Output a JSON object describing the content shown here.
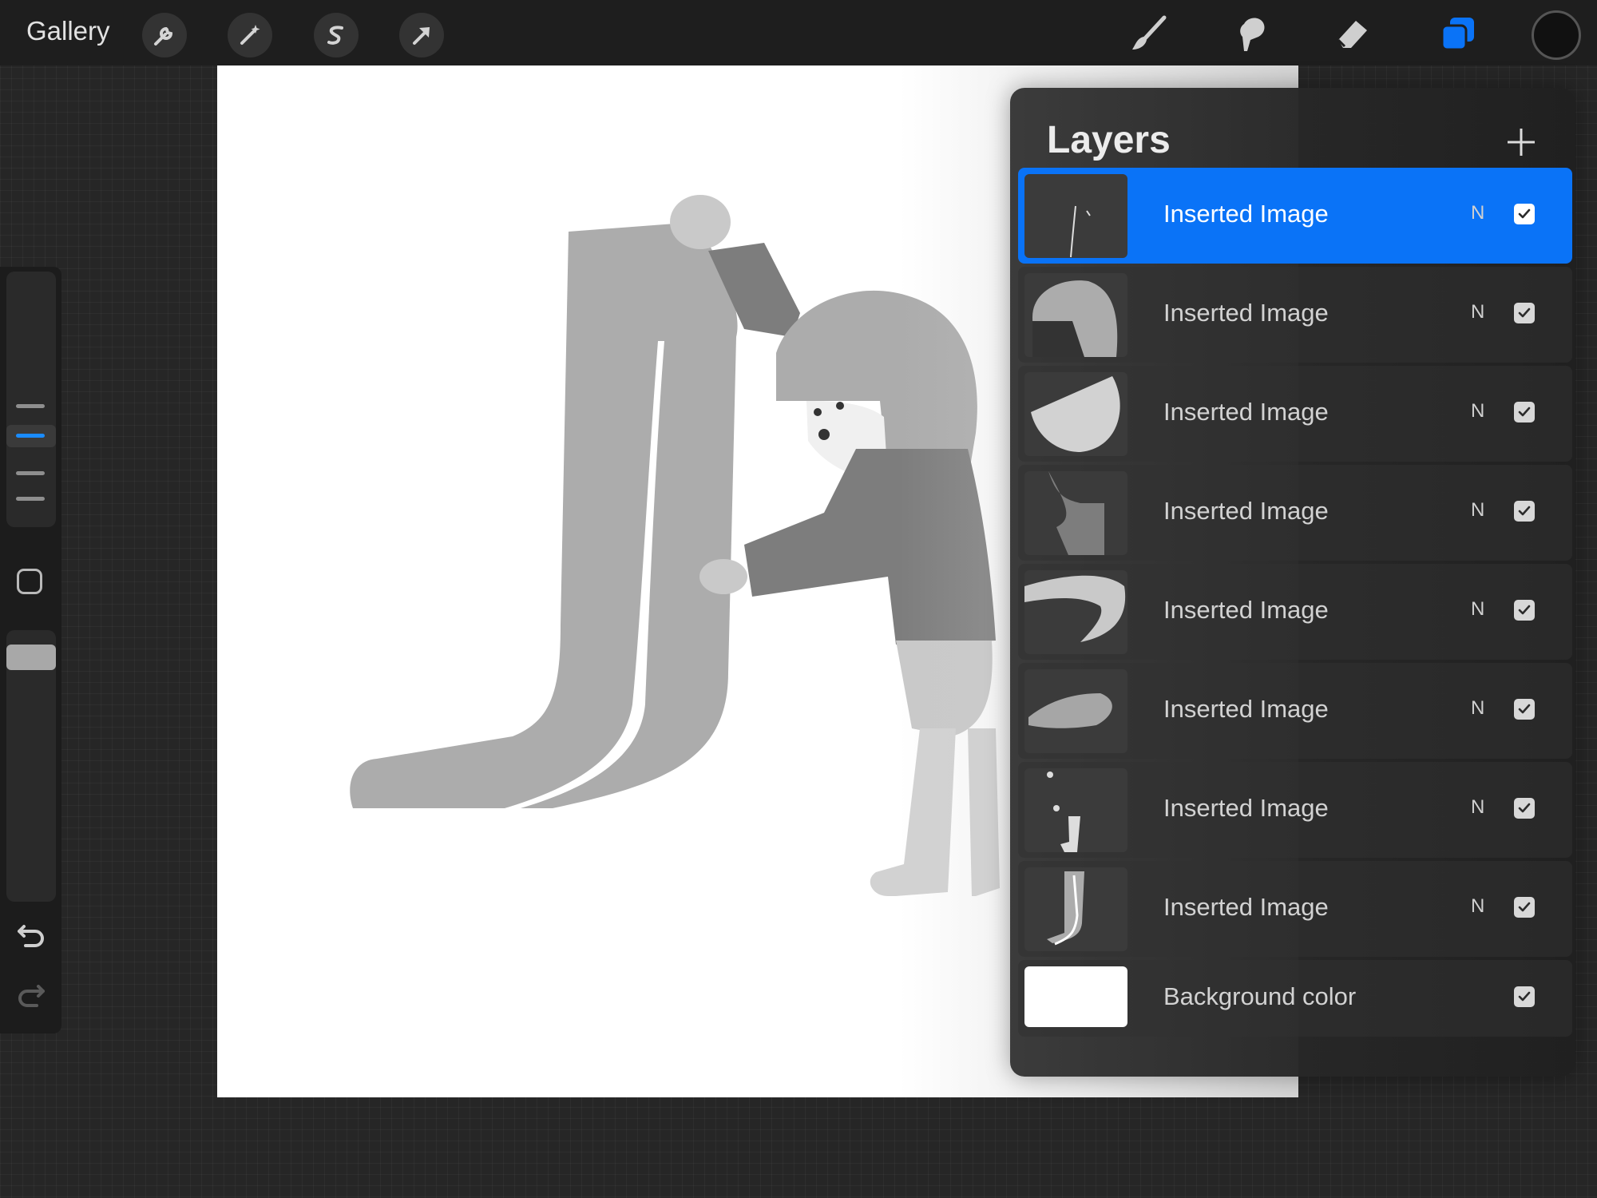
{
  "topbar": {
    "gallery_label": "Gallery",
    "left_tools": [
      "wrench-icon",
      "magic-wand-icon",
      "selection-icon",
      "transform-arrow-icon"
    ],
    "right_tools": [
      "brush-icon",
      "smudge-icon",
      "eraser-icon",
      "layers-icon"
    ],
    "active_tool": "layers",
    "current_color": "#111111",
    "accent_color": "#0a73f7"
  },
  "layers_panel": {
    "title": "Layers",
    "add_icon": "plus-icon",
    "layers": [
      {
        "name": "Inserted Image",
        "blend": "N",
        "visible": true,
        "selected": true
      },
      {
        "name": "Inserted Image",
        "blend": "N",
        "visible": true,
        "selected": false
      },
      {
        "name": "Inserted Image",
        "blend": "N",
        "visible": true,
        "selected": false
      },
      {
        "name": "Inserted Image",
        "blend": "N",
        "visible": true,
        "selected": false
      },
      {
        "name": "Inserted Image",
        "blend": "N",
        "visible": true,
        "selected": false
      },
      {
        "name": "Inserted Image",
        "blend": "N",
        "visible": true,
        "selected": false
      },
      {
        "name": "Inserted Image",
        "blend": "N",
        "visible": true,
        "selected": false
      },
      {
        "name": "Inserted Image",
        "blend": "N",
        "visible": true,
        "selected": false
      }
    ],
    "background": {
      "name": "Background color",
      "visible": true,
      "color": "#ffffff"
    }
  },
  "sidebar": {
    "modify_icon": "square-icon",
    "undo_icon": "undo-icon",
    "redo_icon": "redo-icon"
  }
}
